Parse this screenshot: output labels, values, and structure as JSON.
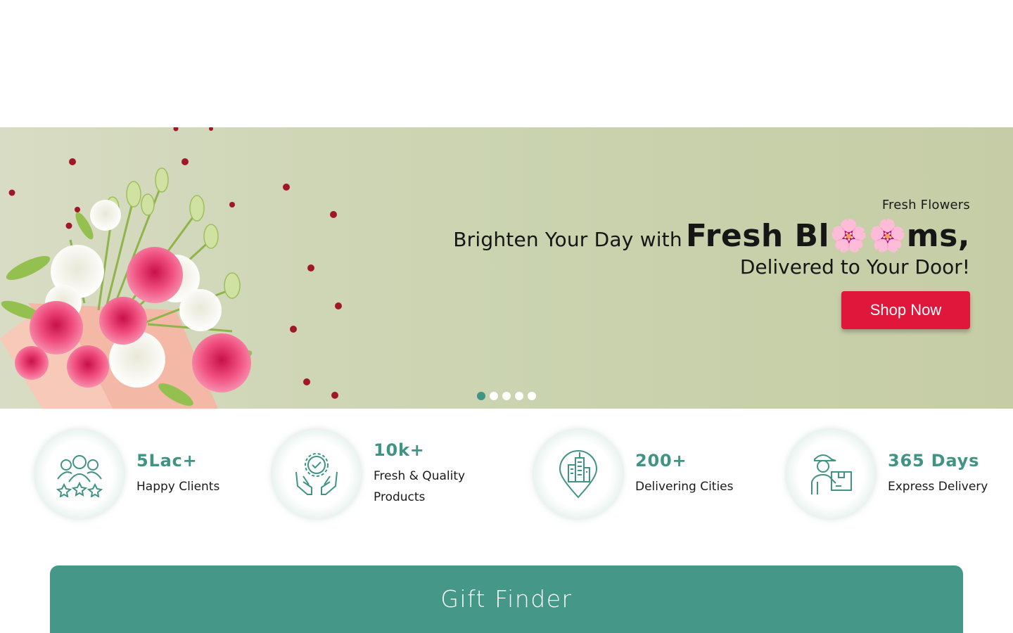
{
  "hero": {
    "eyebrow": "Fresh Flowers",
    "headline_prefix": "Brighten Your Day with",
    "headline_big_start": "Fresh Bl",
    "headline_big_end": "ms,",
    "headline_line2": "Delivered to Your Door!",
    "cta_label": "Shop Now",
    "slide_count": 5,
    "active_slide": 1,
    "blossom_glyph": "🌸"
  },
  "stats": [
    {
      "value": "5Lac+",
      "label": "Happy Clients",
      "icon": "happy-clients-icon"
    },
    {
      "value": "10k+",
      "label": "Fresh & Quality Products",
      "icon": "quality-badge-icon"
    },
    {
      "value": "200+",
      "label": "Delivering Cities",
      "icon": "city-location-icon"
    },
    {
      "value": "365 Days",
      "label": "Express Delivery",
      "icon": "delivery-person-icon"
    }
  ],
  "gift_finder": {
    "title": "Gift Finder"
  },
  "colors": {
    "accent": "#3f9485",
    "gift_bar": "#459887",
    "cta": "#e0163a"
  }
}
